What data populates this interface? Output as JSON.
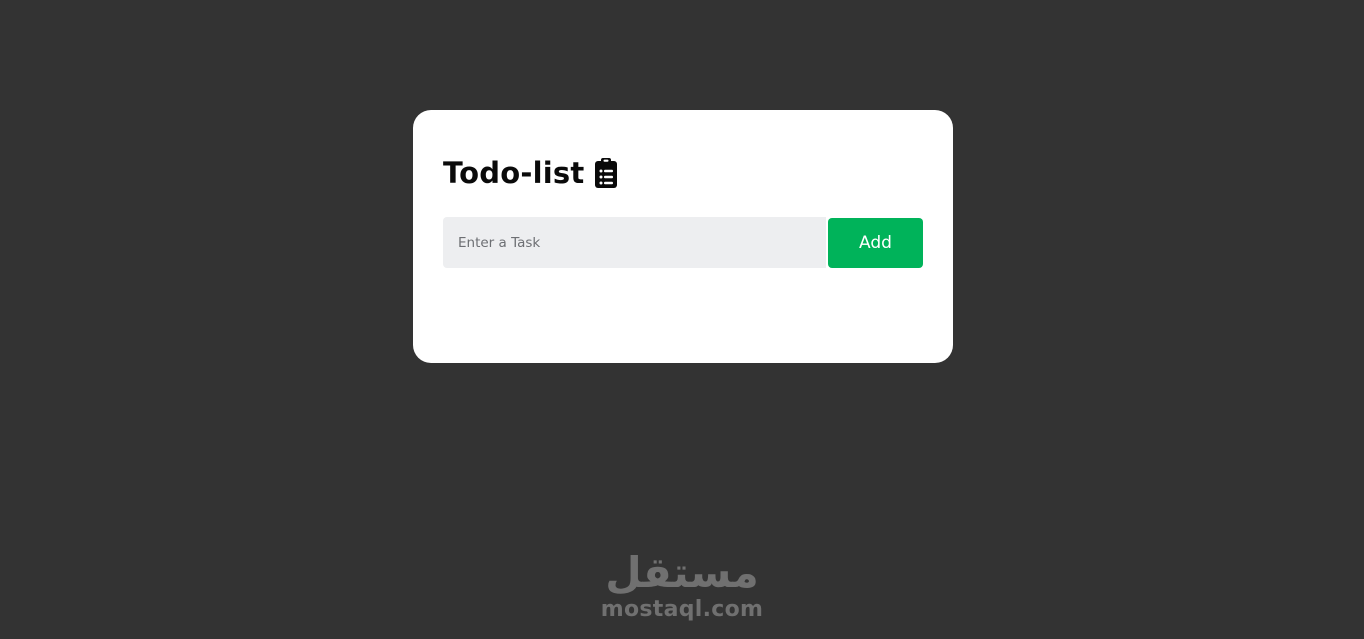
{
  "app": {
    "title": "Todo-list",
    "title_icon": "clipboard-list-icon"
  },
  "task_form": {
    "placeholder": "Enter a Task",
    "value": "",
    "add_label": "Add"
  },
  "watermark": {
    "arabic": "مستقل",
    "latin": "mostaql.com"
  },
  "colors": {
    "background": "#333333",
    "card": "#ffffff",
    "input_bg": "#edeef0",
    "accent": "#00b35a"
  }
}
